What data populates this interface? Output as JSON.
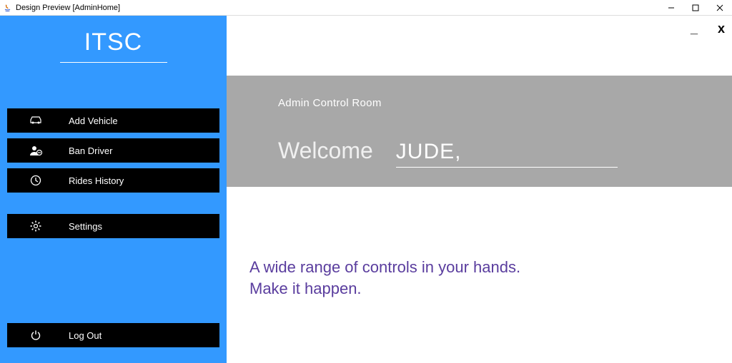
{
  "window": {
    "title": "Design Preview [AdminHome]"
  },
  "sidebar": {
    "logo": "ITSC",
    "items": [
      {
        "label": "Add Vehicle"
      },
      {
        "label": "Ban Driver"
      },
      {
        "label": "Rides History"
      },
      {
        "label": "Settings"
      }
    ],
    "logout": {
      "label": "Log Out"
    }
  },
  "hero": {
    "title": "Admin Control Room",
    "welcome_label": "Welcome",
    "welcome_name": "JUDE,"
  },
  "tagline": {
    "line1": "A wide range of controls in your hands.",
    "line2": "Make it happen."
  }
}
